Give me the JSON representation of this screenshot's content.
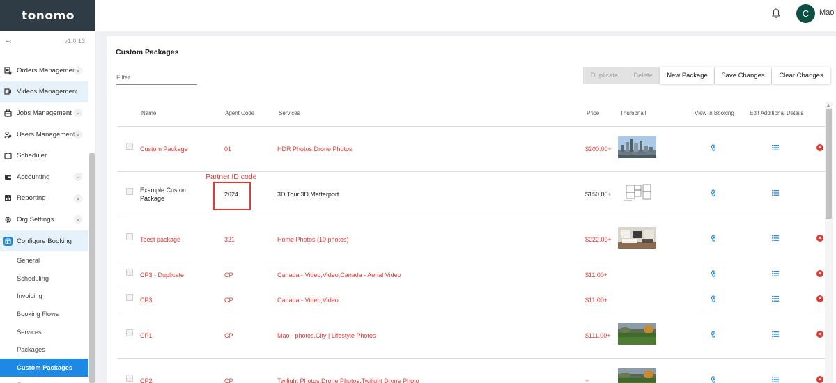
{
  "app": {
    "logo": "tonomo",
    "version": "v1.0.13",
    "user": {
      "initial": "C",
      "name": "Mao"
    }
  },
  "sidebar": {
    "collapse_icon": "≡‹",
    "items": [
      {
        "label": "Orders Management",
        "icon": "orders-icon",
        "expandable": true
      },
      {
        "label": "Videos Management",
        "icon": "videos-icon",
        "expandable": false
      },
      {
        "label": "Jobs Management",
        "icon": "jobs-icon",
        "expandable": true
      },
      {
        "label": "Users Management",
        "icon": "users-icon",
        "expandable": true
      },
      {
        "label": "Scheduler",
        "icon": "calendar-icon",
        "expandable": false
      },
      {
        "label": "Accounting",
        "icon": "accounting-icon",
        "expandable": true
      },
      {
        "label": "Reporting",
        "icon": "reporting-icon",
        "expandable": true
      },
      {
        "label": "Org Settings",
        "icon": "gear-icon",
        "expandable": true
      },
      {
        "label": "Configure Booking",
        "icon": "booking-icon",
        "expandable": false
      }
    ],
    "sub_items": [
      "General",
      "Scheduling",
      "Invoicing",
      "Booking Flows",
      "Services",
      "Packages",
      "Custom Packages",
      "Coupons"
    ],
    "active_sub": "Custom Packages"
  },
  "page": {
    "title": "Custom Packages",
    "filter_placeholder": "Filter",
    "buttons": {
      "duplicate": "Duplicate",
      "delete": "Delete",
      "new_package": "New Package",
      "save": "Save Changes",
      "clear": "Clear Changes"
    }
  },
  "table": {
    "headers": [
      "Name",
      "Agent Code",
      "Services",
      "Price",
      "Thumbnail",
      "View in Booking",
      "Edit Additional Details"
    ],
    "rows": [
      {
        "name": "Custom Package",
        "code": "01",
        "services": "HDR Photos,Drone Photos",
        "price": "$200.00+",
        "thumbnail": "city-skyline",
        "style": "red",
        "deletable": true
      },
      {
        "name": "Example Custom Package",
        "code": "2024",
        "services": "3D Tour,3D Matterport",
        "price": "$150.00+",
        "thumbnail": "floor-plan",
        "style": "dark",
        "deletable": false
      },
      {
        "name": "Teest package",
        "code": "321",
        "services": "Home Photos (10 photos)",
        "price": "$222.00+",
        "thumbnail": "interior-room",
        "style": "red",
        "deletable": true
      },
      {
        "name": "CP3 - Duplicate",
        "code": "CP",
        "services": "Canada - Video,Video,Canada - Aerial Video",
        "price": "$11.00+",
        "thumbnail": "",
        "style": "red",
        "deletable": true
      },
      {
        "name": "CP3",
        "code": "CP",
        "services": "Canada - Video,Video",
        "price": "$11.00+",
        "thumbnail": "",
        "style": "red",
        "deletable": true
      },
      {
        "name": "CP1",
        "code": "CP",
        "services": "Mao - photos,City | Lifestyle Photos",
        "price": "$111.00+",
        "thumbnail": "field-landscape",
        "style": "red",
        "deletable": true
      },
      {
        "name": "CP2",
        "code": "CP",
        "services": "Twilight Photos,Drone Photos,Twilight Drone Photo",
        "price": "+",
        "thumbnail": "field-landscape",
        "style": "red",
        "deletable": true
      }
    ]
  },
  "annotation": {
    "label": "Partner ID code"
  },
  "colors": {
    "accent": "#1e88e5",
    "danger": "#e53935",
    "logo_bar": "#2f3b45",
    "avatar": "#0e4f43"
  }
}
